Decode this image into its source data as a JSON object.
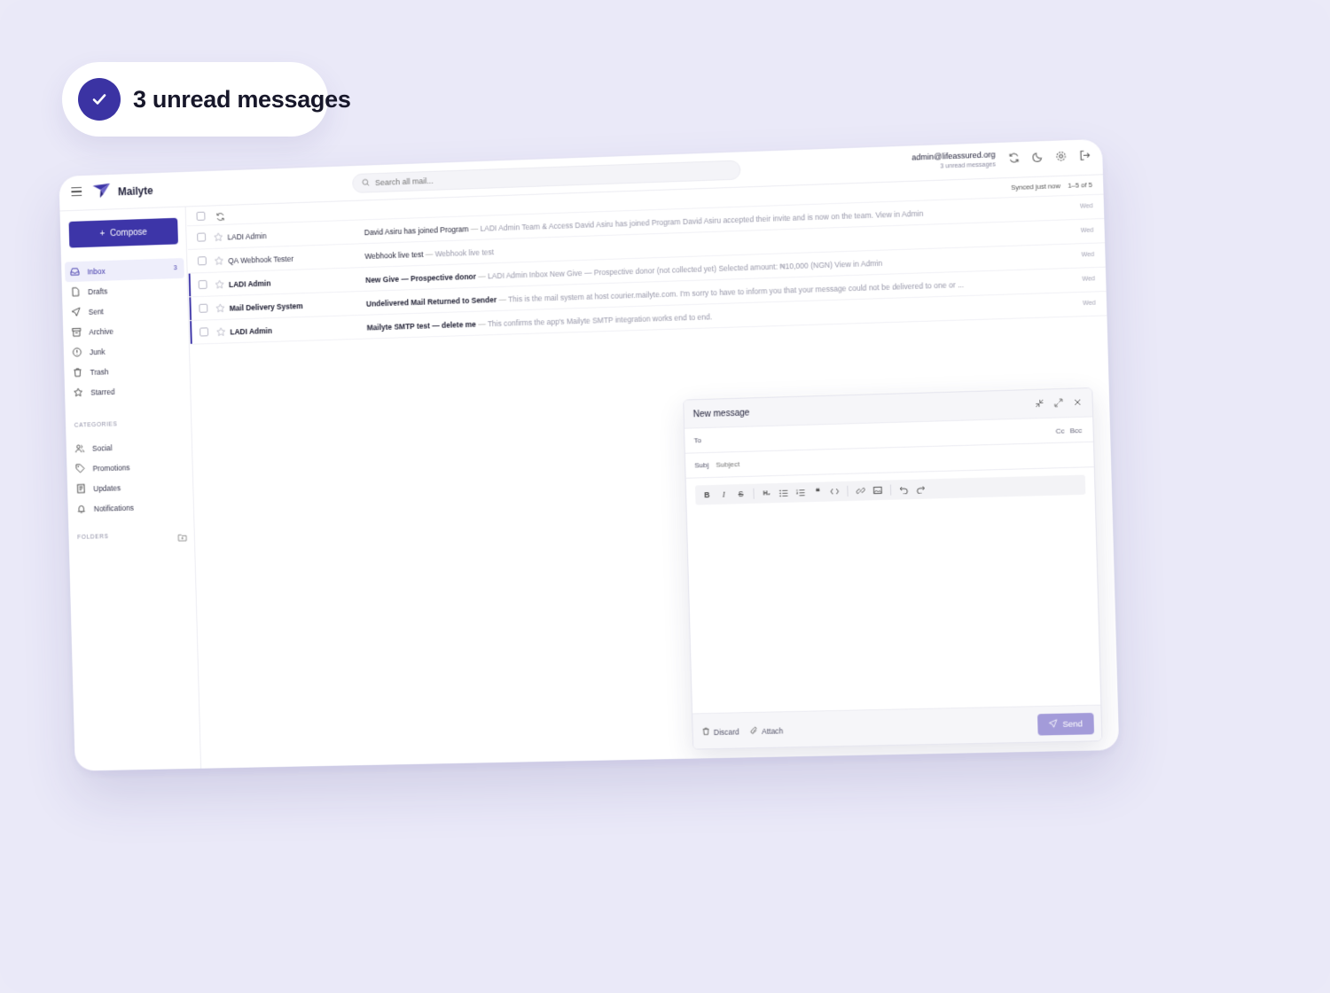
{
  "badge": {
    "text": "3 unread messages"
  },
  "app": {
    "name": "Mailyte",
    "search_placeholder": "Search all mail...",
    "account_email": "admin@lifeassured.org",
    "account_unread": "3 unread messages",
    "synced": "Synced just now",
    "pagination": "1–5 of 5"
  },
  "sidebar": {
    "compose_label": "Compose",
    "items": [
      {
        "label": "Inbox",
        "count": "3",
        "icon": "inbox-icon"
      },
      {
        "label": "Drafts",
        "icon": "file-icon"
      },
      {
        "label": "Sent",
        "icon": "send-icon"
      },
      {
        "label": "Archive",
        "icon": "archive-icon"
      },
      {
        "label": "Junk",
        "icon": "alert-icon"
      },
      {
        "label": "Trash",
        "icon": "trash-icon"
      },
      {
        "label": "Starred",
        "icon": "star-icon"
      }
    ],
    "categories_label": "CATEGORIES",
    "categories": [
      {
        "label": "Social",
        "icon": "users-icon"
      },
      {
        "label": "Promotions",
        "icon": "tag-icon"
      },
      {
        "label": "Updates",
        "icon": "newspaper-icon"
      },
      {
        "label": "Notifications",
        "icon": "bell-icon"
      }
    ],
    "folders_label": "FOLDERS"
  },
  "messages": [
    {
      "sender": "LADI Admin",
      "subject": "David Asiru has joined Program",
      "snippet": "LADI Admin Team & Access David Asiru has joined Program David Asiru accepted their invite and is now on the team. View in Admin",
      "date": "Wed",
      "unread": false
    },
    {
      "sender": "QA Webhook Tester",
      "subject": "Webhook live test",
      "snippet": "Webhook live test",
      "date": "Wed",
      "unread": false
    },
    {
      "sender": "LADI Admin",
      "subject": "New Give — Prospective donor",
      "snippet": "LADI Admin Inbox New Give — Prospective donor (not collected yet) Selected amount: ₦10,000 (NGN) View in Admin",
      "date": "Wed",
      "unread": true
    },
    {
      "sender": "Mail Delivery System",
      "subject": "Undelivered Mail Returned to Sender",
      "snippet": "This is the mail system at host courier.mailyte.com. I'm sorry to have to inform you that your message could not be delivered to one or ...",
      "date": "Wed",
      "unread": true
    },
    {
      "sender": "LADI Admin",
      "subject": "Mailyte SMTP test — delete me",
      "snippet": "This confirms the app's Mailyte SMTP integration works end to end.",
      "date": "Wed",
      "unread": true
    }
  ],
  "compose": {
    "title": "New message",
    "to_label": "To",
    "to_value": "",
    "cc_label": "Cc",
    "bcc_label": "Bcc",
    "subject_label": "Subj",
    "subject_placeholder": "Subject",
    "subject_value": "",
    "discard_label": "Discard",
    "attach_label": "Attach",
    "send_label": "Send"
  },
  "colors": {
    "accent": "#3d35a8",
    "background": "#eae9f8",
    "send_disabled": "#a39bd9"
  }
}
